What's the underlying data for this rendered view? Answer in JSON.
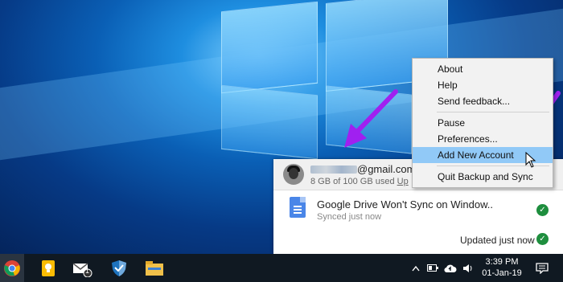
{
  "sync_panel": {
    "email_suffix": "@gmail.com",
    "storage_text": "8 GB of 100 GB used",
    "upgrade_link": "Up",
    "file_name": "Google Drive Won't Sync on Window..",
    "file_status": "Synced just now",
    "footer_status": "Updated just now"
  },
  "context_menu": {
    "items": [
      {
        "label": "About"
      },
      {
        "label": "Help"
      },
      {
        "label": "Send feedback..."
      },
      {
        "label": "Pause"
      },
      {
        "label": "Preferences..."
      },
      {
        "label": "Add New Account",
        "highlighted": true
      },
      {
        "label": "Quit Backup and Sync"
      }
    ]
  },
  "taskbar": {
    "pinned": [
      "chrome-icon",
      "keep-icon",
      "mail-icon",
      "defender-icon",
      "file-explorer-icon"
    ],
    "mail_badge": "1",
    "time": "3:39 PM",
    "date": "01-Jan-19"
  },
  "colors": {
    "menu_highlight": "#91c9f7",
    "arrow": "#a020f0",
    "check": "#1e8e3e",
    "taskbar": "#101922"
  }
}
